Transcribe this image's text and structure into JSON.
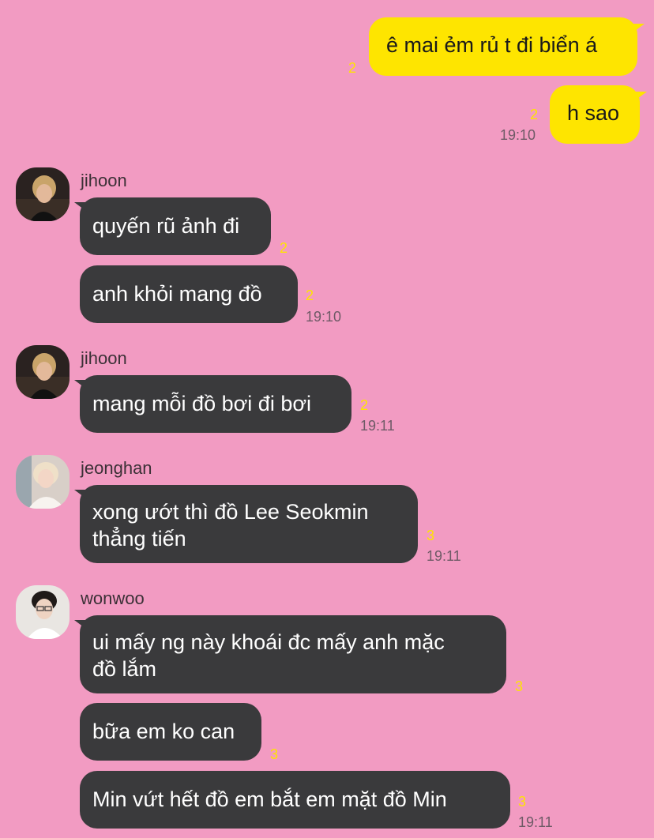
{
  "colors": {
    "background": "#F29BC2",
    "my_bubble": "#FEE500",
    "other_bubble": "#3A3A3C",
    "unread_count": "#FEE500",
    "timestamp": "#6E5A66"
  },
  "messages": {
    "m1": {
      "text": "ê mai ẻm rủ t đi biển á",
      "unread": "2"
    },
    "m2": {
      "text": "h sao",
      "unread": "2",
      "time": "19:10"
    },
    "g1": {
      "sender": "jihoon",
      "avatar_icon": "jihoon-avatar-icon",
      "m1": {
        "text": "quyến rũ ảnh đi",
        "unread": "2"
      },
      "m2": {
        "text": "anh khỏi mang đồ",
        "unread": "2",
        "time": "19:10"
      }
    },
    "g2": {
      "sender": "jihoon",
      "avatar_icon": "jihoon-avatar-icon",
      "m1": {
        "text": "mang mỗi đồ bơi đi bơi",
        "unread": "2",
        "time": "19:11"
      }
    },
    "g3": {
      "sender": "jeonghan",
      "avatar_icon": "jeonghan-avatar-icon",
      "m1": {
        "line1": "xong ướt thì đồ Lee Seokmin",
        "line2": "thẳng tiến",
        "unread": "3",
        "time": "19:11"
      }
    },
    "g4": {
      "sender": "wonwoo",
      "avatar_icon": "wonwoo-avatar-icon",
      "m1": {
        "line1": "ui mấy ng này khoái đc mấy anh mặc",
        "line2": "đồ lắm",
        "unread": "3"
      },
      "m2": {
        "text": "bữa em ko can",
        "unread": "3"
      },
      "m3": {
        "text": "Min vứt hết đồ em bắt em mặt đồ Min",
        "unread": "3",
        "time": "19:11"
      }
    }
  }
}
